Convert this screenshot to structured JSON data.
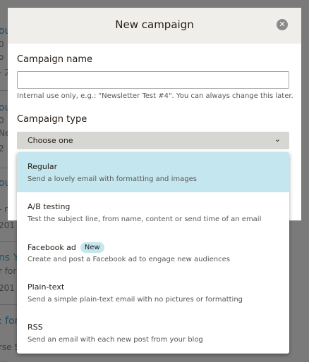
{
  "background": {
    "fragments": [
      "ou",
      "0",
      "o",
      "- 2",
      "ou",
      "0",
      "Ne",
      "2",
      "ou",
      "- r",
      "201",
      "ns Y",
      "r for",
      "201",
      ": for",
      "rse S",
      "..."
    ]
  },
  "modal": {
    "title": "New campaign",
    "close_icon": "close-icon",
    "name_label": "Campaign name",
    "name_value": "",
    "name_placeholder": "",
    "name_help": "Internal use only, e.g.: \"Newsletter Test #4\". You can always change this later.",
    "type_label": "Campaign type",
    "type_select": "Choose one"
  },
  "dropdown": {
    "options": [
      {
        "title": "Regular",
        "desc": "Send a lovely email with formatting and images",
        "selected": true
      },
      {
        "title": "A/B testing",
        "desc": "Test the subject line, from name, content or send time of an email"
      },
      {
        "title": "Facebook ad",
        "badge": "New",
        "desc": "Create and post a Facebook ad to engage new audiences"
      },
      {
        "title": "Plain-text",
        "desc": "Send a simple plain-text email with no pictures or formatting"
      },
      {
        "title": "RSS",
        "desc": "Send an email with each new post from your blog"
      }
    ]
  },
  "colors": {
    "highlight": "#c4e6ee",
    "header_bg": "#efeeea",
    "select_bg": "#d6d6d2"
  }
}
